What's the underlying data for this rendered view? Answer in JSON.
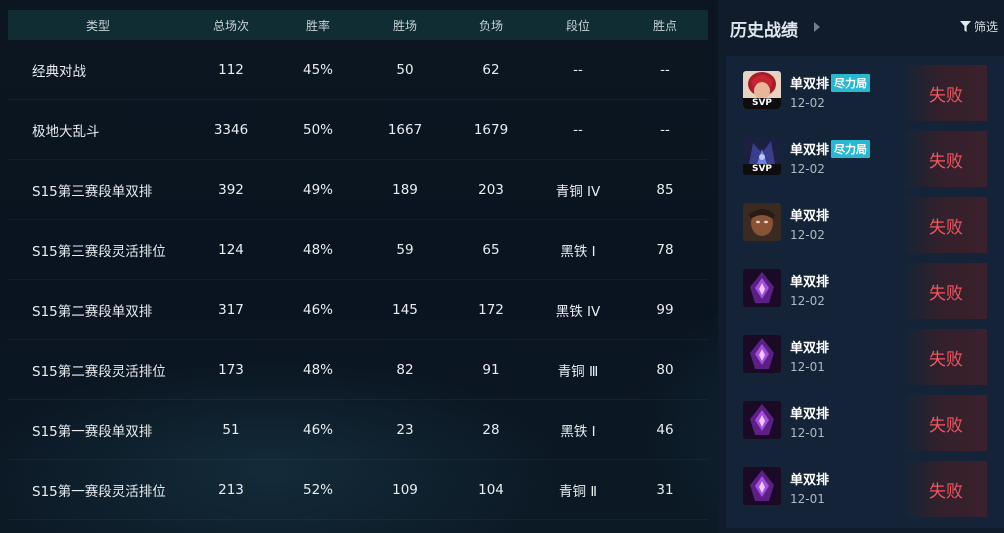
{
  "stats_table": {
    "headers": {
      "type": "类型",
      "total": "总场次",
      "rate": "胜率",
      "wins": "胜场",
      "losses": "负场",
      "rank": "段位",
      "lp": "胜点"
    },
    "rows": [
      {
        "type": "经典对战",
        "total": "112",
        "rate": "45%",
        "wins": "50",
        "losses": "62",
        "rank": "--",
        "lp": "--"
      },
      {
        "type": "极地大乱斗",
        "total": "3346",
        "rate": "50%",
        "wins": "1667",
        "losses": "1679",
        "rank": "--",
        "lp": "--"
      },
      {
        "type": "S15第三赛段单双排",
        "total": "392",
        "rate": "49%",
        "wins": "189",
        "losses": "203",
        "rank": "青铜 IV",
        "lp": "85"
      },
      {
        "type": "S15第三赛段灵活排位",
        "total": "124",
        "rate": "48%",
        "wins": "59",
        "losses": "65",
        "rank": "黑铁 Ⅰ",
        "lp": "78"
      },
      {
        "type": "S15第二赛段单双排",
        "total": "317",
        "rate": "46%",
        "wins": "145",
        "losses": "172",
        "rank": "黑铁 IV",
        "lp": "99"
      },
      {
        "type": "S15第二赛段灵活排位",
        "total": "173",
        "rate": "48%",
        "wins": "82",
        "losses": "91",
        "rank": "青铜 Ⅲ",
        "lp": "80"
      },
      {
        "type": "S15第一赛段单双排",
        "total": "51",
        "rate": "46%",
        "wins": "23",
        "losses": "28",
        "rank": "黑铁 Ⅰ",
        "lp": "46"
      },
      {
        "type": "S15第一赛段灵活排位",
        "total": "213",
        "rate": "52%",
        "wins": "109",
        "losses": "104",
        "rank": "青铜 Ⅱ",
        "lp": "31"
      }
    ]
  },
  "history": {
    "title": "历史战绩",
    "filter_label": "筛选",
    "matches": [
      {
        "mode": "单双排",
        "tag": "尽力局",
        "date": "12-02",
        "result": "失败",
        "badge": "SVP",
        "icon": "red-haired-champion-portrait"
      },
      {
        "mode": "单双排",
        "tag": "尽力局",
        "date": "12-02",
        "result": "失败",
        "badge": "SVP",
        "icon": "dark-blue-champion-portrait"
      },
      {
        "mode": "单双排",
        "tag": "",
        "date": "12-02",
        "result": "失败",
        "badge": "",
        "icon": "dark-skinned-champion-portrait"
      },
      {
        "mode": "单双排",
        "tag": "",
        "date": "12-02",
        "result": "失败",
        "badge": "",
        "icon": "void-purple-champion-portrait"
      },
      {
        "mode": "单双排",
        "tag": "",
        "date": "12-01",
        "result": "失败",
        "badge": "",
        "icon": "void-purple-champion-portrait"
      },
      {
        "mode": "单双排",
        "tag": "",
        "date": "12-01",
        "result": "失败",
        "badge": "",
        "icon": "void-purple-champion-portrait"
      },
      {
        "mode": "单双排",
        "tag": "",
        "date": "12-01",
        "result": "失败",
        "badge": "",
        "icon": "void-purple-champion-portrait"
      }
    ]
  },
  "colors": {
    "header_bg": "#0f2d33",
    "panel_bg": "#101c2c",
    "list_bg": "#142338",
    "loss_red": "#f0575f",
    "tag_cyan": "#29b8d1"
  }
}
